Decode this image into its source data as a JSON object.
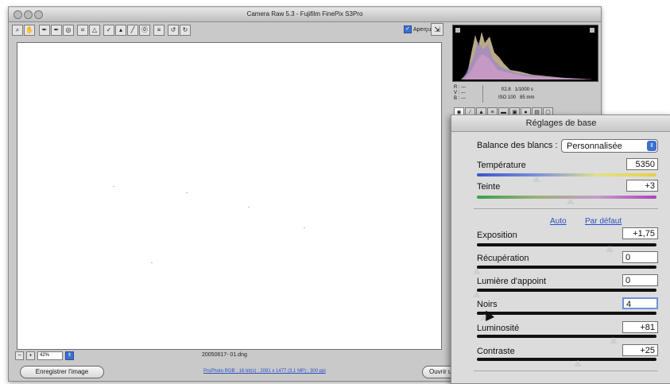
{
  "window": {
    "title": "Camera Raw 5.3  -  Fujifilm FinePix S3Pro"
  },
  "toolbar": {
    "tools": [
      "⌕",
      "✋",
      "✒",
      "✒",
      "◎",
      "⌗",
      "△",
      "✓",
      "▴",
      "╱",
      "⓪",
      "≡",
      "↺",
      "↻"
    ],
    "preview_label": "Aperçu",
    "preview_checked": true
  },
  "bottom": {
    "zoom_value": "42%",
    "filename": "20050617- 01.dng",
    "save_label": "Enregistrer l'image",
    "info_link": "ProPhoto RGB ; 16 bit(s) ; 2091 x 1477 (3,1 MP) ; 300 ppi",
    "open_label": "Ouvrir un"
  },
  "readout": {
    "r_label": "R :",
    "v_label": "V :",
    "b_label": "B :",
    "r_value": "---",
    "v_value": "---",
    "b_value": "---",
    "aperture": "f/2.8",
    "shutter": "1/1000 s",
    "iso": "ISO 100",
    "focal": "85 mm"
  },
  "panel": {
    "title": "Réglages de base",
    "wb_label": "Balance des blancs :",
    "wb_value": "Personnalisée",
    "auto_link": "Auto",
    "default_link": "Par défaut",
    "sliders": [
      {
        "id": "temperature",
        "label": "Température",
        "value": "5350",
        "level": 0.33
      },
      {
        "id": "tint",
        "label": "Teinte",
        "value": "+3",
        "level": 0.52
      },
      {
        "id": "exposure",
        "label": "Exposition",
        "value": "+1,75",
        "level": 0.74
      },
      {
        "id": "recovery",
        "label": "Récupération",
        "value": "0",
        "level": 0.0
      },
      {
        "id": "fill",
        "label": "Lumière d'appoint",
        "value": "0",
        "level": 0.0
      },
      {
        "id": "blacks",
        "label": "Noirs",
        "value": "4",
        "level": 0.04
      },
      {
        "id": "brightness",
        "label": "Luminosité",
        "value": "+81",
        "level": 0.76
      },
      {
        "id": "contrast",
        "label": "Contraste",
        "value": "+25",
        "level": 0.56
      }
    ]
  },
  "colors": {
    "accent": "#3b6fd1",
    "link": "#2a4fc8"
  }
}
